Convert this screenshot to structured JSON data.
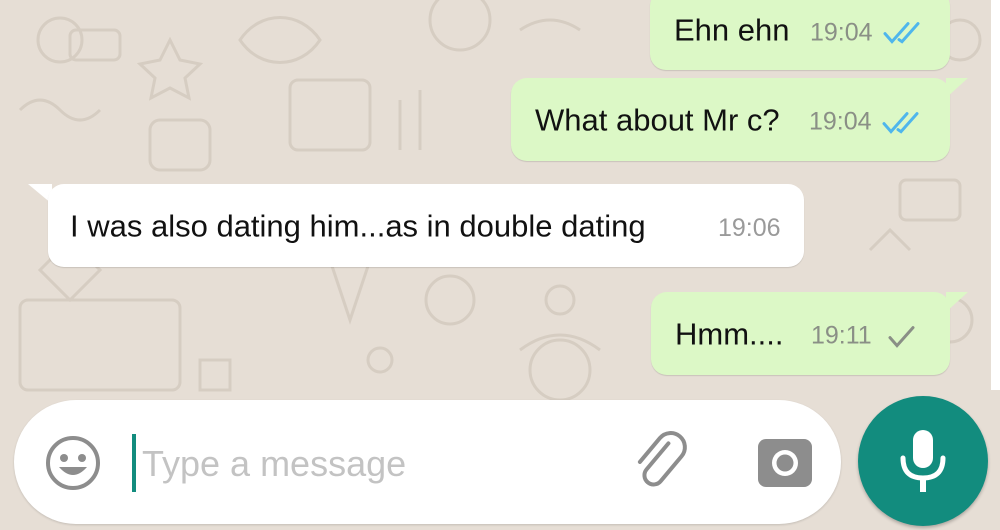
{
  "messages": [
    {
      "direction": "outgoing",
      "text": "Ehn ehn",
      "time": "19:04",
      "status_icon": "double-check-read-icon"
    },
    {
      "direction": "outgoing",
      "text": "What about Mr c?",
      "time": "19:04",
      "status_icon": "double-check-read-icon"
    },
    {
      "direction": "incoming",
      "text": "I was also dating him...as in double dating",
      "time": "19:06"
    },
    {
      "direction": "outgoing",
      "text": "Hmm....",
      "time": "19:11",
      "status_icon": "single-check-sent-icon"
    }
  ],
  "composer": {
    "placeholder": "Type a message",
    "value": "",
    "icons": [
      "emoji-icon",
      "paperclip-icon",
      "camera-icon",
      "microphone-icon"
    ]
  },
  "colors": {
    "outgoing_bubble": "#dcf8c6",
    "incoming_bubble": "#ffffff",
    "read_tick": "#4fb6ec",
    "sent_tick": "#8a8f86",
    "accent": "#128c7e",
    "wallpaper": "#e5ddd5"
  }
}
